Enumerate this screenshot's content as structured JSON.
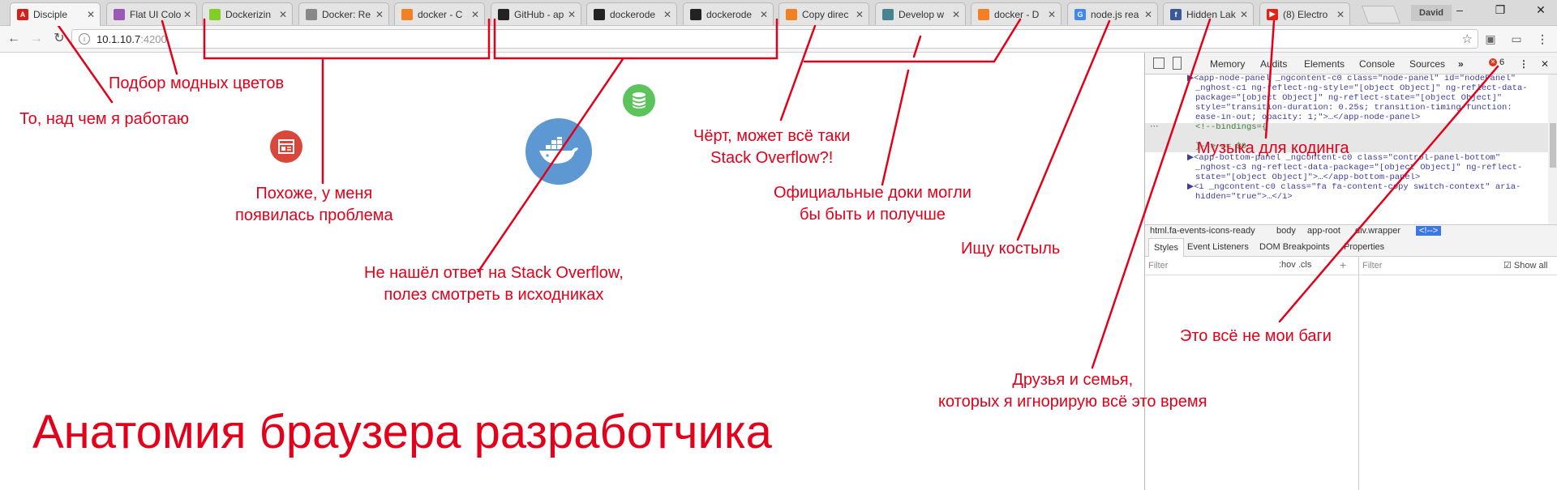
{
  "tabs": [
    {
      "title": "Disciple",
      "icon": "angular-icon",
      "color": "#dd1b16",
      "glyph": "A"
    },
    {
      "title": "Flat UI Colo",
      "icon": "palette-icon",
      "color": "#9b59b6",
      "glyph": ""
    },
    {
      "title": "Dockerizin",
      "icon": "nodejs-icon",
      "color": "#83cd29",
      "glyph": ""
    },
    {
      "title": "Docker: Re",
      "icon": "globe-icon",
      "color": "#888888",
      "glyph": ""
    },
    {
      "title": "docker - C",
      "icon": "stackoverflow-icon",
      "color": "#f48024",
      "glyph": ""
    },
    {
      "title": "GitHub - ap",
      "icon": "github-icon",
      "color": "#222222",
      "glyph": ""
    },
    {
      "title": "dockerode",
      "icon": "github-icon",
      "color": "#222222",
      "glyph": ""
    },
    {
      "title": "dockerode",
      "icon": "github-icon",
      "color": "#222222",
      "glyph": ""
    },
    {
      "title": "Copy direc",
      "icon": "stackoverflow-icon",
      "color": "#f48024",
      "glyph": ""
    },
    {
      "title": "Develop w",
      "icon": "electron-icon",
      "color": "#47848f",
      "glyph": ""
    },
    {
      "title": "docker - D",
      "icon": "stackoverflow-icon",
      "color": "#f48024",
      "glyph": ""
    },
    {
      "title": "node.js rea",
      "icon": "google-icon",
      "color": "#4285f4",
      "glyph": "G"
    },
    {
      "title": "Hidden Lak",
      "icon": "facebook-icon",
      "color": "#3b5998",
      "glyph": "f"
    },
    {
      "title": "(8) Electro",
      "icon": "youtube-icon",
      "color": "#e62117",
      "glyph": "▶"
    }
  ],
  "profile": "David",
  "toolbar": {
    "url_host": "10.1.10.7",
    "url_port": ":4200"
  },
  "devtools": {
    "tabs": [
      "Memory",
      "Audits",
      "Elements",
      "Console",
      "Sources",
      "»"
    ],
    "error_count": "6",
    "dom_lines": [
      "▶<app-node-panel _ngcontent-c0 class=\"node-panel\" id=\"nodePanel\"",
      "_nghost-c1 ng-reflect-ng-style=\"[object Object]\" ng-reflect-data-",
      "package=\"[object Object]\" ng-reflect-state=\"[object Object]\"",
      "style=\"transition-duration: 0.25s; transition-timing-function:",
      "ease-in-out; opacity: 1;\">…</app-node-panel>",
      "<!--bindings={",
      "}--> == $0",
      "▶<app-bottom-panel _ngcontent-c0 class=\"control-panel-bottom\"",
      "_nghost-c3 ng-reflect-data-package=\"[object Object]\" ng-reflect-",
      "state=\"[object Object]\">…</app-bottom-panel>",
      "▶<i _ngcontent-c0 class=\"fa fa-content-copy switch-context\" aria-",
      "hidden=\"true\">…</i>"
    ],
    "breadcrumbs": [
      "html.fa-events-icons-ready",
      "body",
      "app-root",
      "div.wrapper",
      "<!--> "
    ],
    "styles_tabs": [
      "Styles",
      "Event Listeners",
      "DOM Breakpoints",
      "Properties"
    ],
    "filter_placeholder": "Filter",
    "hov_cls": ":hov .cls",
    "filter2_placeholder": "Filter",
    "show_all": "Show all"
  },
  "annotations": {
    "working_on": "То, над чем я работаю",
    "fashion_colors": "Подбор модных цветов",
    "problem": "Похоже, у меня\nпоявилась проблема",
    "source_code": "Не нашёл ответ на Stack Overflow,\nполез смотреть в исходниках",
    "damn_so": "Чёрт, может всё таки\nStack Overflow?!",
    "docs": "Официальные доки могли\nбы быть и получше",
    "crutch": "Ищу костыль",
    "music": "Музыка для кодинга",
    "friends": "Друзья и семья,\nкоторых я игнорирую всё это время",
    "not_my_bugs": "Это всё не мои баги"
  },
  "title": "Анатомия браузера разработчика",
  "colors": {
    "annotation": "#e2001a",
    "docker_blue": "#5d98d2",
    "db_green": "#5dc35c",
    "app_red": "#d9463a"
  }
}
